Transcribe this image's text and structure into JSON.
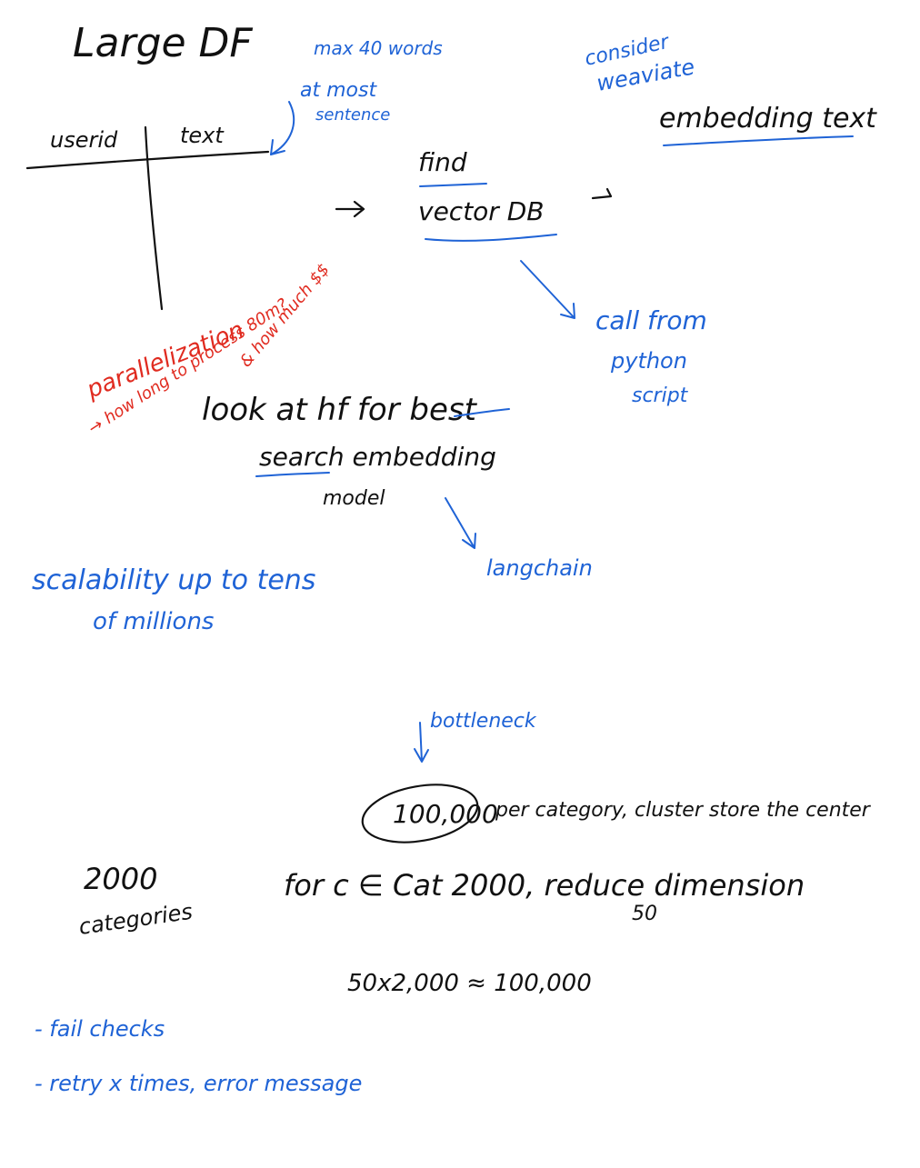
{
  "title": "Large DF",
  "table": {
    "col1": "userid",
    "col2": "text"
  },
  "notes": {
    "max_words": "max 40 words",
    "at_most": "at most",
    "sentence": "sentence",
    "consider": "consider",
    "weaviate": "weaviate",
    "embedding_text": "embedding text",
    "find": "find",
    "vector_db": "vector DB",
    "call_from": "call from",
    "python": "python",
    "script": "script",
    "parallelization": "parallelization",
    "how_long": "→ how long to process 80m?",
    "how_much": "& how much $$",
    "look_at": "look at hf for best",
    "search_embedding": "search embedding",
    "model": "model",
    "langchain": "langchain",
    "scalability": "scalability up to tens",
    "of_millions": "of millions",
    "bottleneck": "bottleneck",
    "hundred_k": "100,000",
    "per_category": "per category, cluster store the center",
    "two_thousand": "2000",
    "categories": "categories",
    "for_c": "for c ∈ Cat 2000, reduce dimension",
    "fifty": "50",
    "equation": "50x2,000 ≈ 100,000",
    "fail_checks": "- fail checks",
    "retry": "- retry x times, error message"
  },
  "colors": {
    "black": "#111111",
    "blue": "#1f63d6",
    "red": "#e02b20"
  }
}
